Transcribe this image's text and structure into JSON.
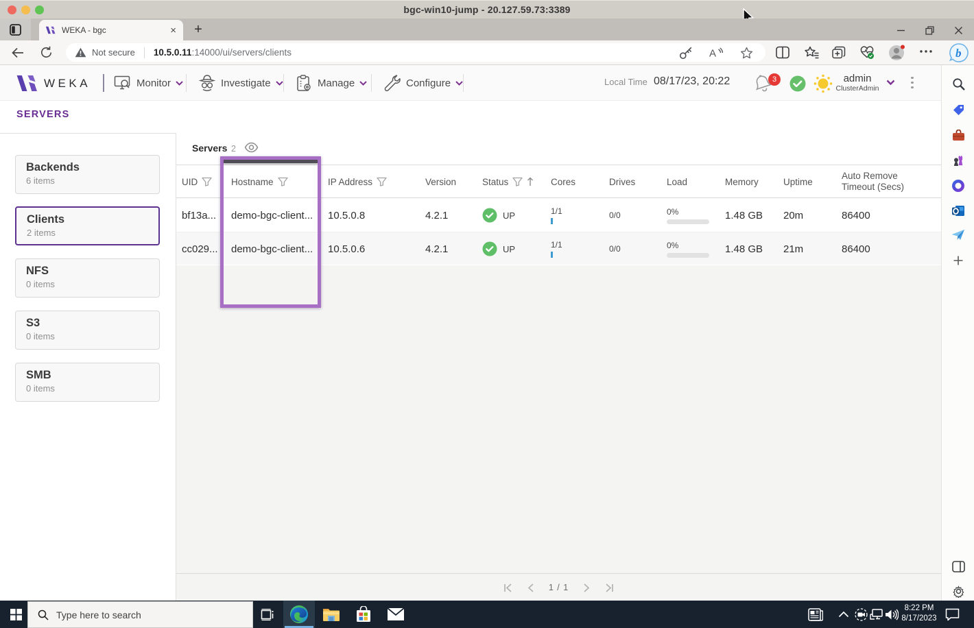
{
  "rdp": {
    "title": "bgc-win10-jump - 20.127.59.73:3389"
  },
  "browser": {
    "tab_title": "WEKA - bgc",
    "tab_close": "×",
    "new_tab": "+",
    "security_label": "Not secure",
    "url_host": "10.5.0.11",
    "url_rest": ":14000/ui/servers/clients"
  },
  "weka": {
    "brand": "WEKA",
    "nav": [
      {
        "label": "Monitor"
      },
      {
        "label": "Investigate"
      },
      {
        "label": "Manage"
      },
      {
        "label": "Configure"
      }
    ],
    "local_time_label": "Local Time",
    "local_time_value": "08/17/23, 20:22",
    "notification_count": "3",
    "user": {
      "name": "admin",
      "role": "ClusterAdmin"
    },
    "page_title": "SERVERS",
    "sidebar_cards": [
      {
        "title": "Backends",
        "subtitle": "6 items"
      },
      {
        "title": "Clients",
        "subtitle": "2 items"
      },
      {
        "title": "NFS",
        "subtitle": "0 items"
      },
      {
        "title": "S3",
        "subtitle": "0 items"
      },
      {
        "title": "SMB",
        "subtitle": "0 items"
      }
    ],
    "table": {
      "title": "Servers",
      "count": "2",
      "columns": {
        "uid": "UID",
        "hostname": "Hostname",
        "ip": "IP Address",
        "version": "Version",
        "status": "Status",
        "cores": "Cores",
        "drives": "Drives",
        "load": "Load",
        "memory": "Memory",
        "uptime": "Uptime",
        "timeout_line1": "Auto Remove",
        "timeout_line2": "Timeout (Secs)"
      },
      "rows": [
        {
          "uid": "bf13a...",
          "hostname": "demo-bgc-client...",
          "ip": "10.5.0.8",
          "version": "4.2.1",
          "status": "UP",
          "cores": "1/1",
          "drives": "0/0",
          "load": "0%",
          "memory": "1.48 GB",
          "uptime": "20m",
          "timeout": "86400"
        },
        {
          "uid": "cc029...",
          "hostname": "demo-bgc-client...",
          "ip": "10.5.0.6",
          "version": "4.2.1",
          "status": "UP",
          "cores": "1/1",
          "drives": "0/0",
          "load": "0%",
          "memory": "1.48 GB",
          "uptime": "21m",
          "timeout": "86400"
        }
      ],
      "pagination": "1 / 1"
    }
  },
  "taskbar": {
    "search_placeholder": "Type here to search",
    "clock_time": "8:22 PM",
    "clock_date": "8/17/2023"
  },
  "colors": {
    "weka_brand_purple": "#6d4cbc",
    "page_title_purple": "#692e94",
    "selected_card_border": "#5c3190",
    "column_highlight_purple": "#a870c5",
    "status_up_green": "#5fbf68",
    "notification_badge_red": "#e53935",
    "cores_bar_blue": "#3d9bd1",
    "edge_active_underline": "#79b2e2",
    "taskbar_navy": "#18222f"
  }
}
